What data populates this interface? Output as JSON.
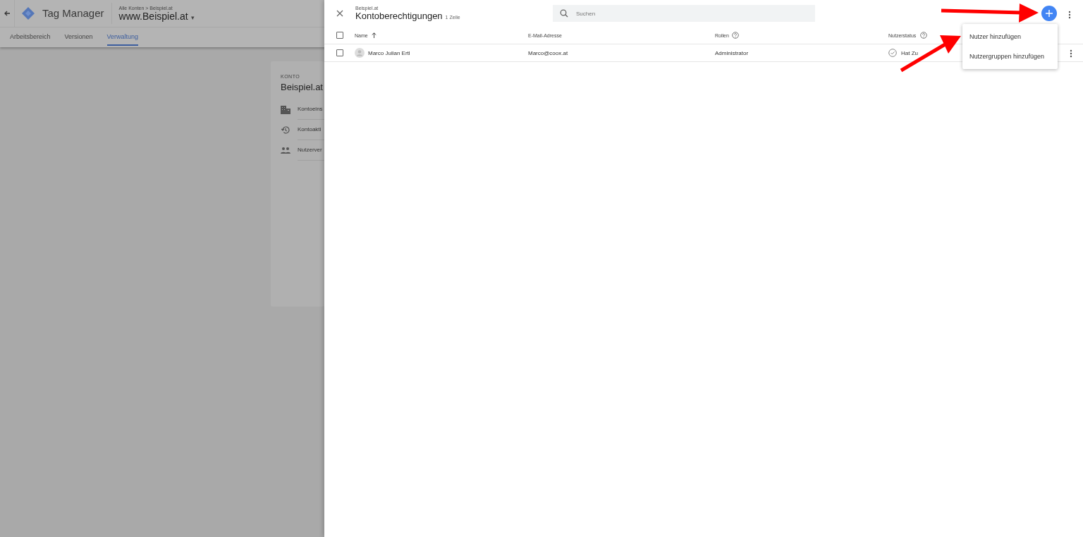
{
  "app": {
    "name": "Tag Manager",
    "breadcrumb": "Alle Konten > Beispiel.at",
    "container": "www.Beispiel.at",
    "caret": "▾"
  },
  "tabs": [
    {
      "label": "Arbeitsbereich",
      "selected": false
    },
    {
      "label": "Versionen",
      "selected": false
    },
    {
      "label": "Verwaltung",
      "selected": true
    }
  ],
  "account_card": {
    "overline": "KONTO",
    "title": "Beispiel.at",
    "items": [
      {
        "kind": "building",
        "label": "Kontoeins"
      },
      {
        "kind": "history",
        "label": "Kontoakti"
      },
      {
        "kind": "people",
        "label": "Nutzerver"
      }
    ]
  },
  "panel": {
    "breadcrumb": "Beispiel.at",
    "title": "Kontoberechtigungen",
    "count": "1 Zeile",
    "search": {
      "placeholder": "Suchen"
    },
    "select_all": {
      "checked": false
    },
    "columns": [
      {
        "label": "Name",
        "sort": true,
        "help": false
      },
      {
        "label": "E-Mail-Adresse",
        "sort": false,
        "help": false
      },
      {
        "label": "Rollen",
        "sort": false,
        "help": true
      },
      {
        "label": "Nutzerstatus",
        "sort": false,
        "help": true
      }
    ],
    "rows": [
      {
        "checked": false,
        "name": "Marco Julian Ertl",
        "email": "Marco@coox.at",
        "role": "Administrator",
        "status": "Hat Zu"
      }
    ]
  },
  "menu": [
    {
      "label": "Nutzer hinzufügen"
    },
    {
      "label": "Nutzergruppen hinzufügen"
    }
  ]
}
